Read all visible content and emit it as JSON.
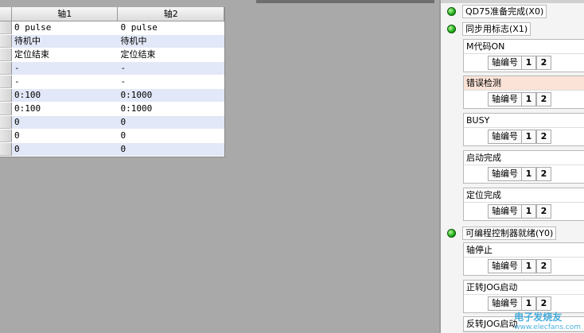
{
  "table": {
    "headers": [
      "轴1",
      "轴2"
    ],
    "rows": [
      [
        "0 pulse",
        "0 pulse"
      ],
      [
        "待机中",
        "待机中"
      ],
      [
        "定位结束",
        "定位结束"
      ],
      [
        "-",
        "-"
      ],
      [
        "-",
        "-"
      ],
      [
        "0:100",
        "0:1000"
      ],
      [
        "0:100",
        "0:1000"
      ],
      [
        "0",
        "0"
      ],
      [
        "0",
        "0"
      ],
      [
        "0",
        "0"
      ]
    ]
  },
  "signals": {
    "x0": "QD75准备完成(X0)",
    "x1": "同步用标志(X1)",
    "y0": "可编程控制器就绪(Y0)"
  },
  "boxes": {
    "axis_label": "轴编号",
    "axis1": "1",
    "axis2": "2",
    "m_code": "M代码ON",
    "error": "错误检测",
    "busy": "BUSY",
    "start_done": "启动完成",
    "pos_done": "定位完成",
    "axis_stop": "轴停止",
    "fwd_jog": "正转JOG启动",
    "rev_jog": "反转JOG启动"
  },
  "colors": {
    "led": "#26b21e",
    "row_alt": "#e3e8f8",
    "error_bg": "#fbe3d8",
    "workspace": "#a9a9a9"
  },
  "watermark": {
    "line1": "电子发烧友",
    "line2": "www.elecfans.com"
  }
}
